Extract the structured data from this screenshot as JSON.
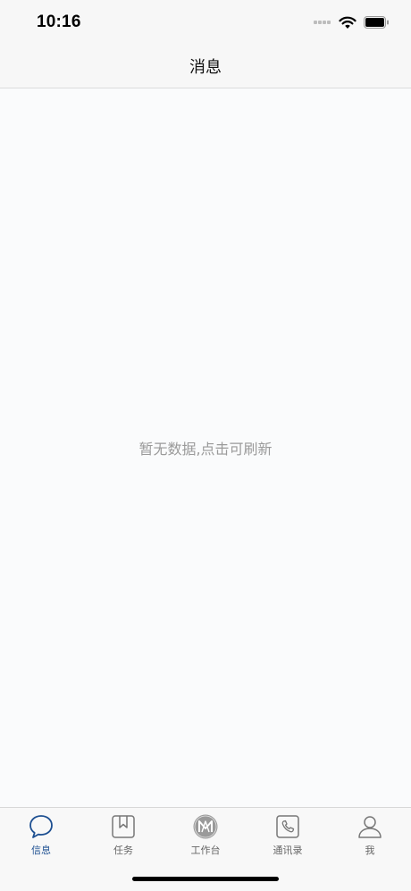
{
  "status_bar": {
    "time": "10:16"
  },
  "header": {
    "title": "消息"
  },
  "content": {
    "empty_message": "暂无数据,点击可刷新"
  },
  "tabbar": {
    "active_index": 0,
    "active_color": "#1d4f91",
    "inactive_color": "#666666",
    "items": [
      {
        "label": "信息",
        "icon": "chat-bubble-icon"
      },
      {
        "label": "任务",
        "icon": "bookmark-task-icon"
      },
      {
        "label": "工作台",
        "icon": "workbench-logo-icon"
      },
      {
        "label": "通讯录",
        "icon": "phone-contacts-icon"
      },
      {
        "label": "我",
        "icon": "user-profile-icon"
      }
    ]
  }
}
